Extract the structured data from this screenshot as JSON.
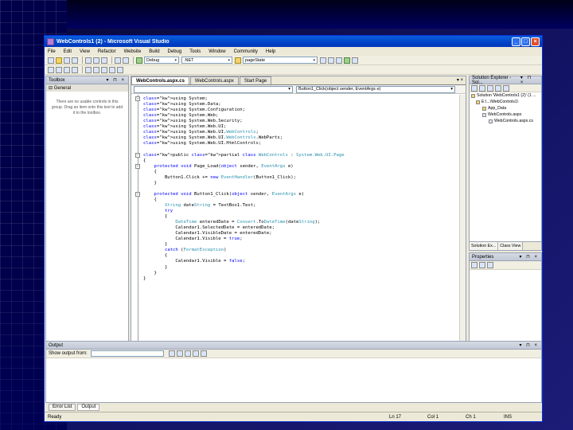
{
  "window": {
    "title": "WebControls1 (2) - Microsoft Visual Studio",
    "buttons": {
      "minimize": "_",
      "maximize": "□",
      "close": "×"
    }
  },
  "menu": [
    "File",
    "Edit",
    "View",
    "Refactor",
    "Website",
    "Build",
    "Debug",
    "Tools",
    "Window",
    "Community",
    "Help"
  ],
  "toolbar": {
    "config": "Debug",
    "platform": ".NET",
    "find": "pageState"
  },
  "toolbox": {
    "title": "Toolbox",
    "buttons": "▾ ⊓ ×",
    "group": "⊟ General",
    "empty_message": "There are no usable controls in this group. Drag an item onto this text to add it to the toolbox."
  },
  "editor": {
    "tabs": [
      "WebControls.aspx.cs",
      "WebControls.aspx",
      "Start Page"
    ],
    "active_tab": 0,
    "tab_close": "▾ ×",
    "nav_left": "",
    "nav_right": "Button1_Click(object sender, EventArgs e)",
    "code_lines": [
      "using System;",
      "using System.Data;",
      "using System.Configuration;",
      "using System.Web;",
      "using System.Web.Security;",
      "using System.Web.UI;",
      "using System.Web.UI.WebControls;",
      "using System.Web.UI.WebControls.WebParts;",
      "using System.Web.UI.HtmlControls;",
      "",
      "public partial class WebControls : System.Web.UI.Page",
      "{",
      "    protected void Page_Load(object sender, EventArgs e)",
      "    {",
      "        Button1.Click += new EventHandler(Button1_Click);",
      "    }",
      "",
      "    protected void Button1_Click(object sender, EventArgs e)",
      "    {",
      "        String dateString = TextBox1.Text;",
      "        try",
      "        {",
      "            DateTime enteredDate = Convert.ToDateTime(dateString);",
      "            Calendar1.SelectedDate = enteredDate;",
      "            Calendar1.VisibleDate = enteredDate;",
      "            Calendar1.Visible = true;",
      "        }",
      "        catch (FormatException)",
      "        {",
      "            Calendar1.Visible = false;",
      "        }",
      "    }",
      "}"
    ]
  },
  "solution_explorer": {
    "title": "Solution Explorer - Sol...",
    "buttons": "▾ ⊓ ×",
    "items": [
      "Solution 'WebControls1 (2)' (1 ...",
      "E:\\...\\WebControls1\\",
      "App_Data",
      "WebControls.aspx",
      "WebControls.aspx.cs"
    ],
    "tabs": [
      "Solution Ex...",
      "Class View"
    ]
  },
  "properties": {
    "title": "Properties",
    "buttons": "▾ ⊓ ×"
  },
  "output": {
    "title": "Output",
    "buttons": "▾ ⊓ ×",
    "show_output_from": "Show output from:"
  },
  "bottom_tabs": [
    "Error List",
    "Output"
  ],
  "status": {
    "text": "Ready",
    "ln": "Ln 17",
    "col": "Col 1",
    "ch": "Ch 1",
    "mode": "INS"
  }
}
